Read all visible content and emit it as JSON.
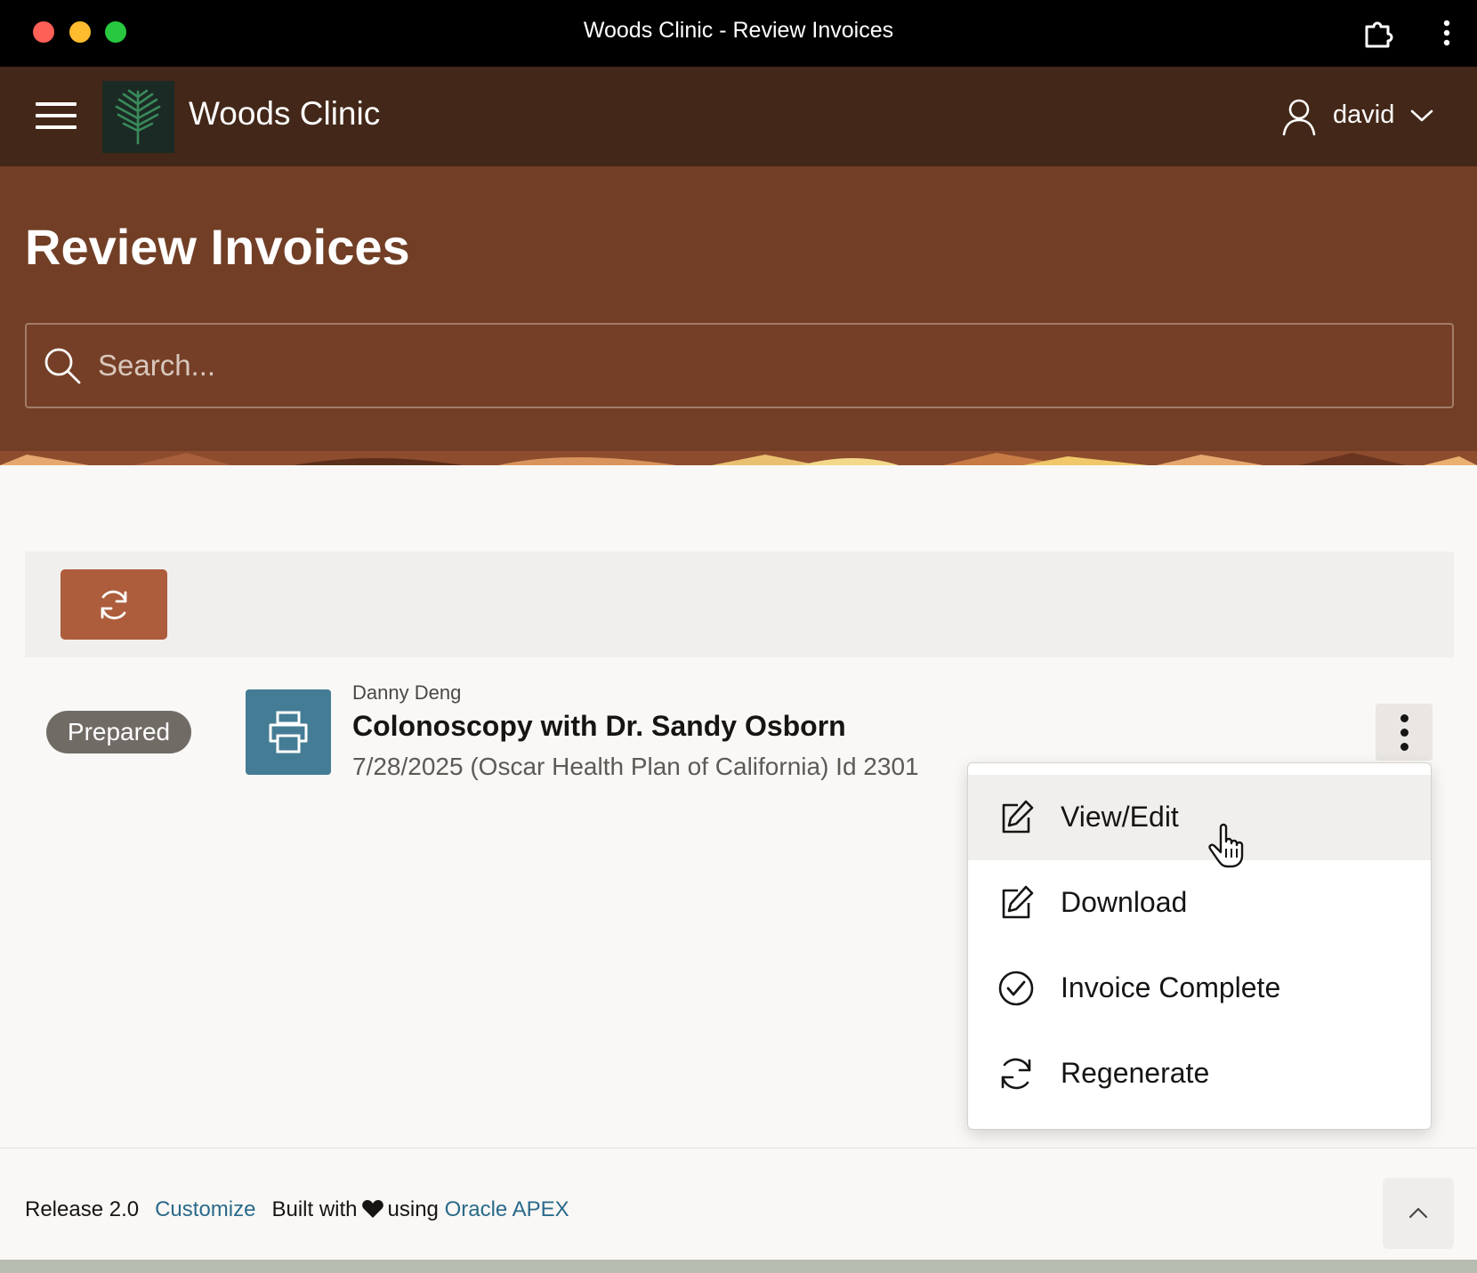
{
  "window": {
    "title": "Woods Clinic - Review Invoices"
  },
  "header": {
    "app_name": "Woods Clinic",
    "user_name": "david"
  },
  "page": {
    "title": "Review Invoices",
    "search": {
      "placeholder": "Search...",
      "value": ""
    }
  },
  "toolbar": {
    "refresh_icon": "refresh-icon"
  },
  "invoice": {
    "status": "Prepared",
    "patient": "Danny Deng",
    "title": "Colonoscopy with Dr. Sandy Osborn",
    "subtitle": "7/28/2025 (Oscar Health Plan of California) Id 2301",
    "icon": "printer-icon"
  },
  "actions_menu": {
    "items": [
      {
        "label": "View/Edit",
        "icon": "edit-icon",
        "active": true
      },
      {
        "label": "Download",
        "icon": "edit-icon",
        "active": false
      },
      {
        "label": "Invoice Complete",
        "icon": "check-circle-icon",
        "active": false
      },
      {
        "label": "Regenerate",
        "icon": "refresh-icon",
        "active": false
      }
    ]
  },
  "footer": {
    "release": "Release 2.0",
    "customize": "Customize",
    "built_with": "Built with",
    "using": "using",
    "oracle_apex": "Oracle APEX"
  },
  "colors": {
    "header_bg": "#432718",
    "hero_bg": "#723f26",
    "refresh_button": "#ad5d3c",
    "invoice_icon_bg": "#457c95",
    "status_badge_bg": "#716b66",
    "link": "#2a6a8a"
  }
}
